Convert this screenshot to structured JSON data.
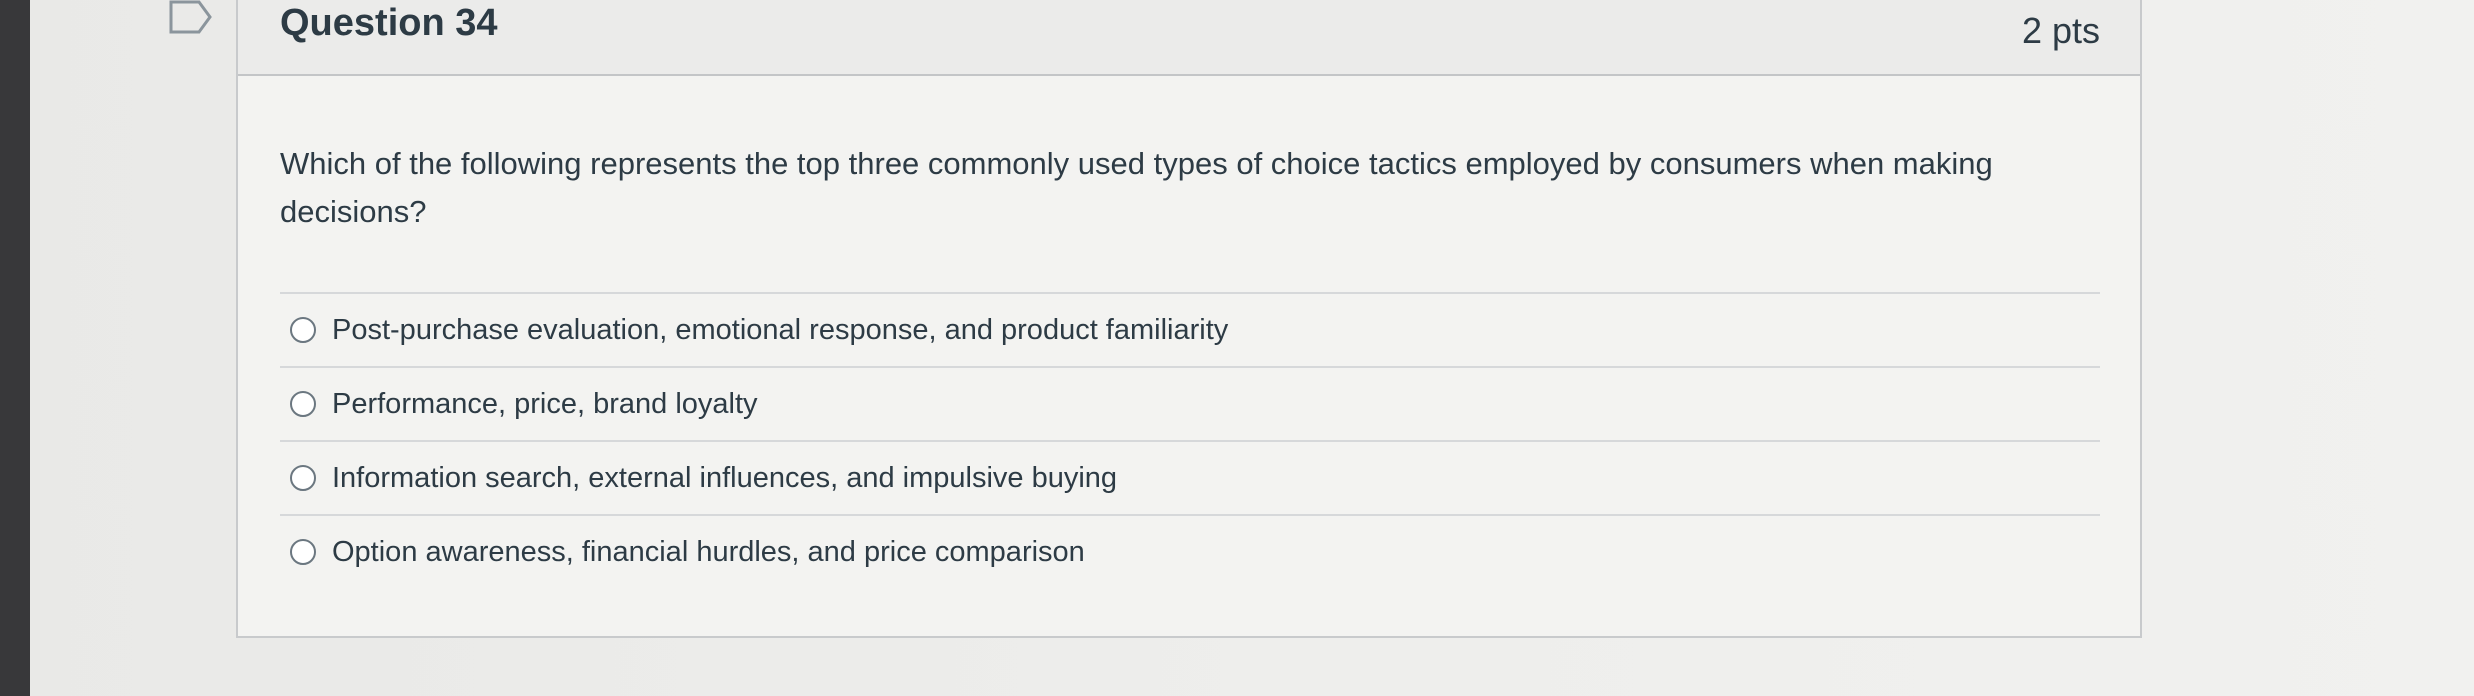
{
  "question": {
    "title": "Question 34",
    "points": "2 pts",
    "text": "Which of the following represents the top three commonly used types of choice tactics employed by consumers when making decisions?",
    "answers": [
      "Post-purchase evaluation, emotional response, and product familiarity",
      "Performance, price, brand loyalty",
      "Information search, external influences, and impulsive buying",
      "Option awareness, financial hurdles, and price comparison"
    ]
  },
  "icons": {
    "flag": "flag-question-icon"
  },
  "colors": {
    "text": "#2d3b45",
    "border": "#c8cacc",
    "left_bar": "#38383a"
  }
}
